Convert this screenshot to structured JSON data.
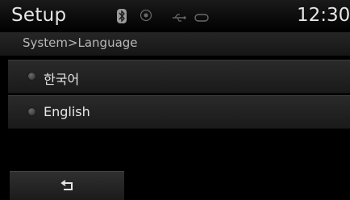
{
  "header": {
    "title": "Setup",
    "time": "12:30",
    "status_icons": [
      "bluetooth-icon",
      "target-icon",
      "usb-icon",
      "link-icon"
    ]
  },
  "breadcrumb": {
    "text": "System>Language"
  },
  "languages": [
    {
      "label": "한국어"
    },
    {
      "label": "English"
    }
  ],
  "footer": {
    "back_icon": "back-arrow-icon"
  },
  "colors": {
    "background": "#000000",
    "text": "#e6e6e6",
    "muted": "#b8b8b8"
  }
}
